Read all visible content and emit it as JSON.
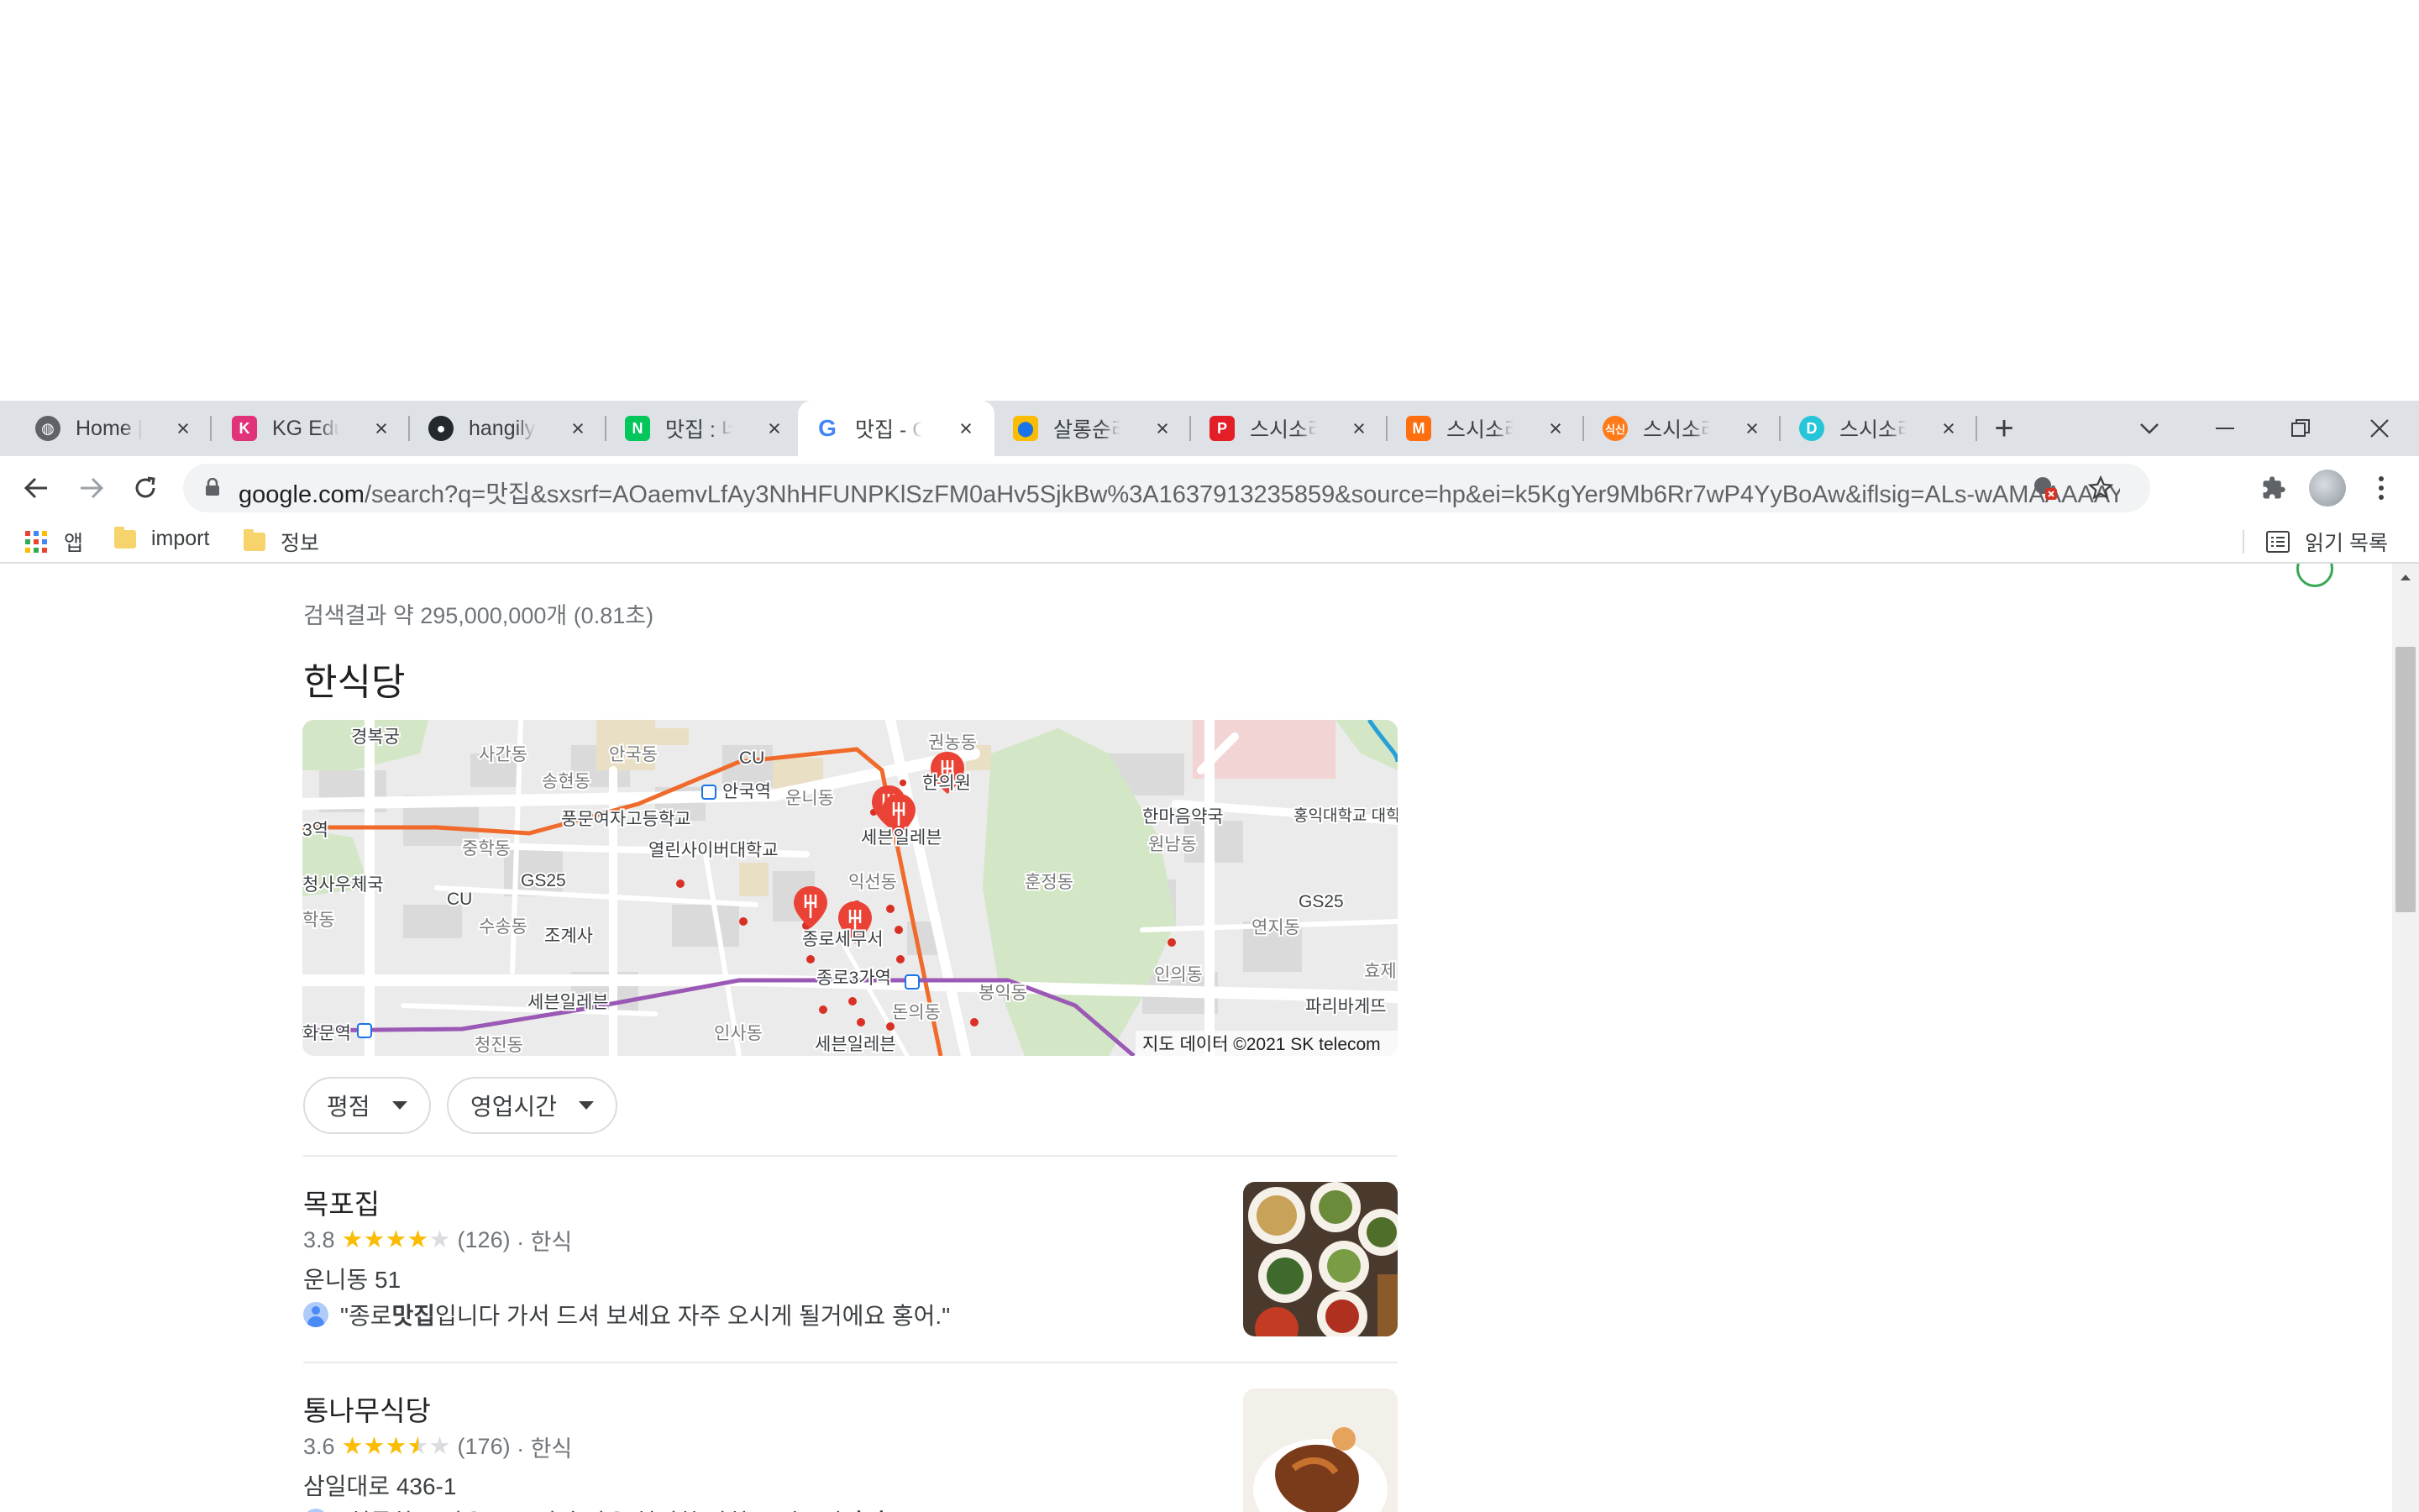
{
  "tabs": [
    {
      "title": "Home | Lf",
      "icon": "globe-icon",
      "color": "#5f6368",
      "active": false
    },
    {
      "title": "KG Eduon",
      "icon": "kg-eduone-icon",
      "color": "#e0337a",
      "active": false
    },
    {
      "title": "hangilyon",
      "icon": "github-icon",
      "color": "#24292e",
      "active": false
    },
    {
      "title": "맛집 : 네이",
      "icon": "naver-icon",
      "color": "#03c75a",
      "active": false
    },
    {
      "title": "맛집 - Go",
      "icon": "google-icon",
      "color": "#4285f4",
      "active": true
    },
    {
      "title": "살롱순라",
      "icon": "map-pin-icon",
      "color": "#fbbc04",
      "active": false
    },
    {
      "title": "스시소라",
      "icon": "p-icon",
      "color": "#e41e26",
      "active": false
    },
    {
      "title": "스시소라",
      "icon": "m-icon",
      "color": "#ff6f0f",
      "active": false
    },
    {
      "title": "스시소라",
      "icon": "siksin-icon",
      "color": "#ff7a18",
      "active": false
    },
    {
      "title": "스시소라",
      "icon": "d-icon",
      "color": "#27c5d9",
      "active": false
    }
  ],
  "toolbar": {
    "url_host": "google.com",
    "url_rest": "/search?q=맛집&sxsrf=AOaemvLfAy3NhHFUNPKlSzFM0aHv5SjkBw%3A1637913235859&source=hp&ei=k5KgYer9Mb6Rr7wP4YyBoAw&iflsig=ALs-wAMAAAAAYaCg..."
  },
  "bookmarks": {
    "apps": "앱",
    "items": [
      "import",
      "정보"
    ],
    "reading_list": "읽기 목록"
  },
  "search": {
    "stats": "검색결과 약 295,000,000개 (0.81초)",
    "section_title": "한식당"
  },
  "map": {
    "labels": [
      "경복궁",
      "사간동",
      "안국동",
      "CU",
      "송현동",
      "안국역",
      "운니동",
      "권농동",
      "풍문여자고등학교",
      "열린사이버대학교",
      "한의원",
      "세븐일레븐",
      "한마음약국",
      "원남동",
      "홍익대학교 대학로캠퍼스",
      "학동",
      "중학동",
      "GS25",
      "CU",
      "익선동",
      "훈정동",
      "GS25",
      "청사우체국",
      "수송동",
      "조계사",
      "종로세무서",
      "연지동",
      "종로3가역",
      "인의동",
      "효제",
      "세븐일레븐",
      "봉익동",
      "돈의동",
      "파리바게뜨",
      "화문역",
      "청진동",
      "인사동",
      "세븐일레븐",
      "3역"
    ],
    "attribution": "지도 데이터 ©2021 SK telecom",
    "accent_subway_orange": "#f06a2c",
    "accent_subway_purple": "#9b59b6",
    "pin_color": "#ea4335"
  },
  "filters": [
    "평점",
    "영업시간"
  ],
  "places": [
    {
      "name": "목포집",
      "rating": "3.8",
      "stars": 3.8,
      "reviews": "(126)",
      "category": "· 한식",
      "address": "운니동 51",
      "review_pre": "\"종로 ",
      "review_bold": "맛집",
      "review_post": "입니다 가서 드셔 보세요 자주 오시게 될거에요 홍어.\""
    },
    {
      "name": "통나무식당",
      "rating": "3.6",
      "stars": 3.6,
      "reviews": "(176)",
      "category": "· 한식",
      "address": "삼일대로 436-1",
      "review_pre": "\"허름하고 작은 노포지만 많은 현지화 반찬도 연그릭 ",
      "review_bold": "맛집",
      "review_post": ".\""
    }
  ],
  "colors": {
    "star": "#fbbc04",
    "star_empty": "#dadce0"
  }
}
